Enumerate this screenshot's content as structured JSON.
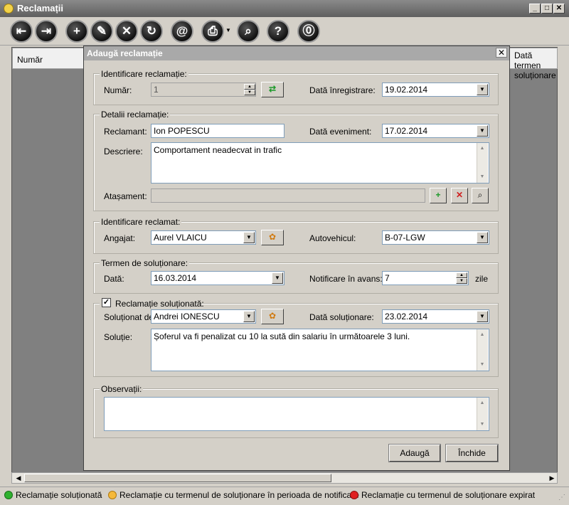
{
  "window": {
    "title": "Reclamații",
    "min": "_",
    "max": "□",
    "close": "✕"
  },
  "toolbar": {
    "buttons": [
      {
        "icon": "first-icon",
        "glyph": "⇤"
      },
      {
        "icon": "exit-icon",
        "glyph": "⇥"
      },
      {
        "icon": "add-icon",
        "glyph": "+"
      },
      {
        "icon": "edit-icon",
        "glyph": "✎"
      },
      {
        "icon": "delete-icon",
        "glyph": "✕"
      },
      {
        "icon": "refresh-icon",
        "glyph": "↻"
      },
      {
        "icon": "email-icon",
        "glyph": "@"
      },
      {
        "icon": "print-icon",
        "glyph": "⎙"
      },
      {
        "icon": "search-icon",
        "glyph": "⌕"
      },
      {
        "icon": "help-icon",
        "glyph": "?"
      },
      {
        "icon": "info-icon",
        "glyph": "⓪"
      }
    ]
  },
  "grid": {
    "col_number": "Număr",
    "col_due_line1": "Dată termen",
    "col_due_line2": "soluționare"
  },
  "dialog": {
    "title": "Adaugă reclamație",
    "close": "✕",
    "ident": {
      "title": "Identificare reclamație:",
      "numar_label": "Număr:",
      "numar_value": "1",
      "data_inreg_label": "Dată înregistrare:",
      "data_inreg_value": "19.02.2014"
    },
    "detalii": {
      "title": "Detalii reclamație:",
      "reclamant_label": "Reclamant:",
      "reclamant_value": "Ion POPESCU",
      "data_ev_label": "Dată eveniment:",
      "data_ev_value": "17.02.2014",
      "descriere_label": "Descriere:",
      "descriere_value": "Comportament neadecvat in trafic",
      "atasament_label": "Atașament:",
      "atasament_value": ""
    },
    "reclamat": {
      "title": "Identificare reclamat:",
      "angajat_label": "Angajat:",
      "angajat_value": "Aurel VLAICU",
      "auto_label": "Autovehicul:",
      "auto_value": "B-07-LGW"
    },
    "termen": {
      "title": "Termen de soluționare:",
      "data_label": "Dată:",
      "data_value": "16.03.2014",
      "notif_label": "Notificare în avans:",
      "notif_value": "7",
      "notif_unit": "zile"
    },
    "solutionata": {
      "title": "Reclamație soluționată:",
      "checked": "✓",
      "solutionat_label": "Soluționat de:",
      "solutionat_value": "Andrei IONESCU",
      "data_sol_label": "Dată soluționare:",
      "data_sol_value": "23.02.2014",
      "solutie_label": "Soluție:",
      "solutie_value": "Șoferul va fi penalizat cu 10 la sută din salariu în următoarele 3 luni."
    },
    "observatii": {
      "title": "Observații:",
      "value": ""
    },
    "buttons": {
      "add": "Adaugă",
      "close": "Închide"
    }
  },
  "legend": {
    "items": [
      {
        "label": "Reclamație soluționată",
        "color": "#2fb12f"
      },
      {
        "label": "Reclamație cu termenul de soluționare în perioada de notificare",
        "color": "#f5b93a"
      },
      {
        "label": "Reclamație cu termenul de soluționare expirat",
        "color": "#e02020"
      }
    ]
  }
}
